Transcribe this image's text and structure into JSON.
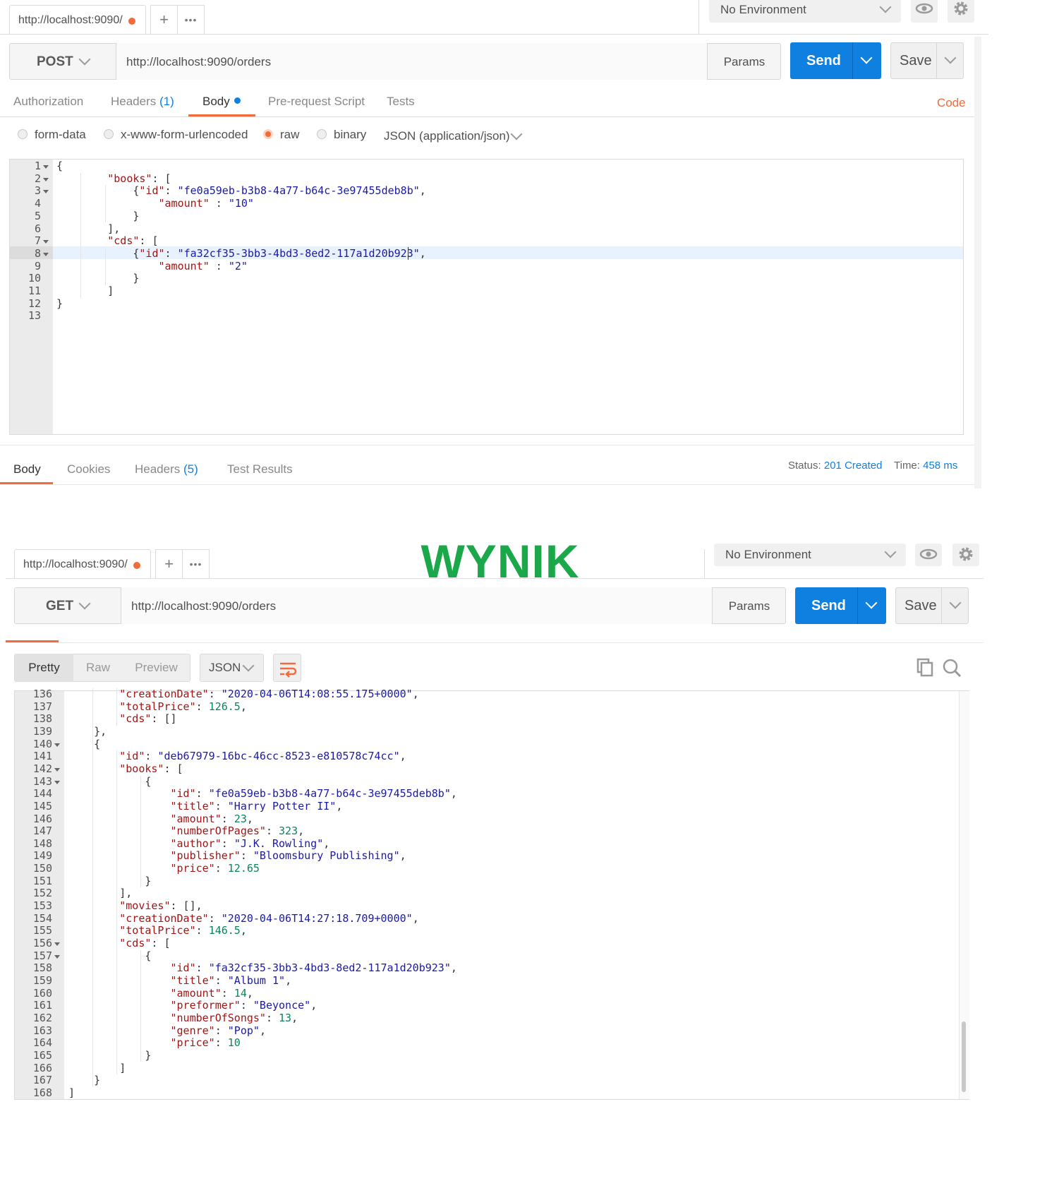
{
  "request": {
    "tab_url": "http://localhost:9090/",
    "plus": "+",
    "more": "•••",
    "environment": "No Environment",
    "method": "POST",
    "url": "http://localhost:9090/orders",
    "params_label": "Params",
    "send_label": "Send",
    "save_label": "Save",
    "tabs": {
      "authorization": "Authorization",
      "headers": "Headers",
      "headers_count": "(1)",
      "body": "Body",
      "prerequest": "Pre-request Script",
      "tests": "Tests",
      "code": "Code"
    },
    "body_types": {
      "form_data": "form-data",
      "urlencoded": "x-www-form-urlencoded",
      "raw": "raw",
      "binary": "binary",
      "content_type": "JSON (application/json)"
    },
    "line_numbers": [
      "1",
      "2",
      "3",
      "4",
      "5",
      "6",
      "7",
      "8",
      "9",
      "10",
      "11",
      "12",
      "13"
    ],
    "code": [
      "{",
      "        \"books\": [",
      "            {\"id\": \"fe0a59eb-b3b8-4a77-b64c-3e97455deb8b\",",
      "                \"amount\" : \"10\"",
      "            }",
      "        ],",
      "        \"cds\": [",
      "            {\"id\": \"fa32cf35-3bb3-4bd3-8ed2-117a1d20b923\",",
      "                \"amount\" : \"2\"",
      "            }",
      "        ]",
      "}",
      ""
    ]
  },
  "response": {
    "tabs": {
      "body": "Body",
      "cookies": "Cookies",
      "headers": "Headers",
      "headers_count": "(5)",
      "test_results": "Test Results"
    },
    "status_label": "Status:",
    "status_value": "201 Created",
    "time_label": "Time:",
    "time_value": "458 ms"
  },
  "divider_title": "WYNIK",
  "result": {
    "tab_url": "http://localhost:9090/",
    "plus": "+",
    "more": "•••",
    "environment": "No Environment",
    "method": "GET",
    "url": "http://localhost:9090/orders",
    "params_label": "Params",
    "send_label": "Send",
    "save_label": "Save",
    "view_modes": {
      "pretty": "Pretty",
      "raw": "Raw",
      "preview": "Preview"
    },
    "format": "JSON",
    "line_numbers": [
      "136",
      "137",
      "138",
      "139",
      "140",
      "141",
      "142",
      "143",
      "144",
      "145",
      "146",
      "147",
      "148",
      "149",
      "150",
      "151",
      "152",
      "153",
      "154",
      "155",
      "156",
      "157",
      "158",
      "159",
      "160",
      "161",
      "162",
      "163",
      "164",
      "165",
      "166",
      "167",
      "168"
    ],
    "code": [
      "        \"creationDate\": \"2020-04-06T14:08:55.175+0000\",",
      "        \"totalPrice\": 126.5,",
      "        \"cds\": []",
      "    },",
      "    {",
      "        \"id\": \"deb67979-16bc-46cc-8523-e810578c74cc\",",
      "        \"books\": [",
      "            {",
      "                \"id\": \"fe0a59eb-b3b8-4a77-b64c-3e97455deb8b\",",
      "                \"title\": \"Harry Potter II\",",
      "                \"amount\": 23,",
      "                \"numberOfPages\": 323,",
      "                \"author\": \"J.K. Rowling\",",
      "                \"publisher\": \"Bloomsbury Publishing\",",
      "                \"price\": 12.65",
      "            }",
      "        ],",
      "        \"movies\": [],",
      "        \"creationDate\": \"2020-04-06T14:27:18.709+0000\",",
      "        \"totalPrice\": 146.5,",
      "        \"cds\": [",
      "            {",
      "                \"id\": \"fa32cf35-3bb3-4bd3-8ed2-117a1d20b923\",",
      "                \"title\": \"Album 1\",",
      "                \"amount\": 14,",
      "                \"preformer\": \"Beyonce\",",
      "                \"numberOfSongs\": 13,",
      "                \"genre\": \"Pop\",",
      "                \"price\": 10",
      "            }",
      "        ]",
      "    }",
      "]"
    ]
  },
  "colors": {
    "accent_orange": "#f26b3a",
    "send_blue": "#0f7fe0",
    "wynik_green": "#1aa84a",
    "json_key": "#a31515",
    "json_string": "#1a1aa6",
    "json_number": "#098658"
  },
  "icons": [
    "chevron-down-icon",
    "eye-icon",
    "gear-icon",
    "wrap-lines-icon",
    "copy-icon",
    "search-icon"
  ]
}
